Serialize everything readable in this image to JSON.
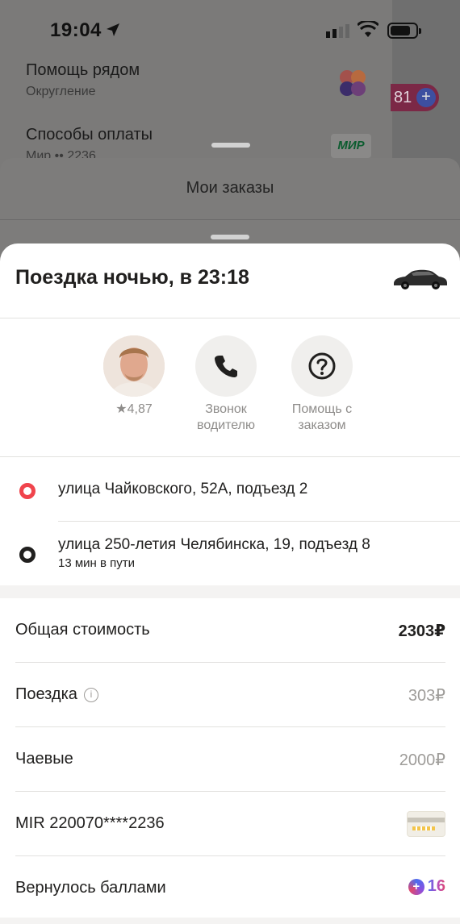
{
  "status": {
    "time": "19:04"
  },
  "background": {
    "rows": [
      {
        "title": "Помощь рядом",
        "subtitle": "Округление"
      },
      {
        "title": "Способы оплаты",
        "subtitle": "Мир •• 2236"
      }
    ],
    "mir_label": "МИР",
    "badge_value": "81",
    "orders_title": "Мои заказы"
  },
  "trip": {
    "title": "Поездка ночью, в 23:18",
    "driver_rating": "★4,87",
    "call_label": "Звонок водителю",
    "help_label": "Помощь с заказом",
    "from": "улица Чайковского, 52А, подъезд 2",
    "to": "улица 250-летия Челябинска, 19, подъезд 8",
    "duration": "13 мин в пути"
  },
  "costs": {
    "total_label": "Общая стоимость",
    "total_value": "2303₽",
    "ride_label": "Поездка",
    "ride_value": "303₽",
    "tips_label": "Чаевые",
    "tips_value": "2000₽",
    "card_label": "MIR 220070****2236",
    "bonus_label": "Вернулось баллами",
    "bonus_value": "16"
  },
  "colors": {
    "from_point": "#f0444c",
    "to_point": "#21201f"
  }
}
